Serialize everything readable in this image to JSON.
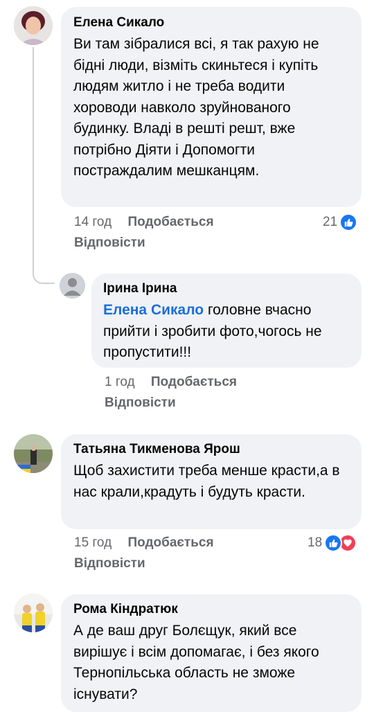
{
  "comments": [
    {
      "author": "Елена Сикало",
      "text": "Ви там зібралися всі, я так рахую не бідні люди, візміть скиньтеся і купіть людям житло і не треба водити хороводи навколо зруйнованого будинку. Владі в решті решт, вже потрібно Діяти і Допомогти постраждалим мешканцям.",
      "time": "14 год",
      "like": "Подобається",
      "reply": "Відповісти",
      "reaction_count": "21",
      "reactions": [
        "like-icon"
      ]
    },
    {
      "author": "Ірина Ірина",
      "mention": "Елена Сикало",
      "text": " головне вчасно прийти і зробити фото,чогось не пропустити!!!",
      "time": "1 год",
      "like": "Подобається",
      "reply": "Відповісти"
    },
    {
      "author": "Татьяна Тикменова Ярош",
      "text": "Щоб захистити треба менше красти,а в нас крали,крадуть і будуть красти.",
      "time": "15 год",
      "like": "Подобається",
      "reply": "Відповісти",
      "reaction_count": "18",
      "reactions": [
        "like-icon",
        "love-icon"
      ]
    },
    {
      "author": "Рома Кіндратюк",
      "text": "А де ваш друг Болєщук, який все вирішує і всім допомагає, і без якого Тернопільська область не зможе існувати?"
    }
  ],
  "colors": {
    "bubble": "#f0f2f5",
    "meta": "#65676b",
    "mention": "#1a6fd8",
    "like": "#1877f2",
    "love": "#f33e58"
  }
}
